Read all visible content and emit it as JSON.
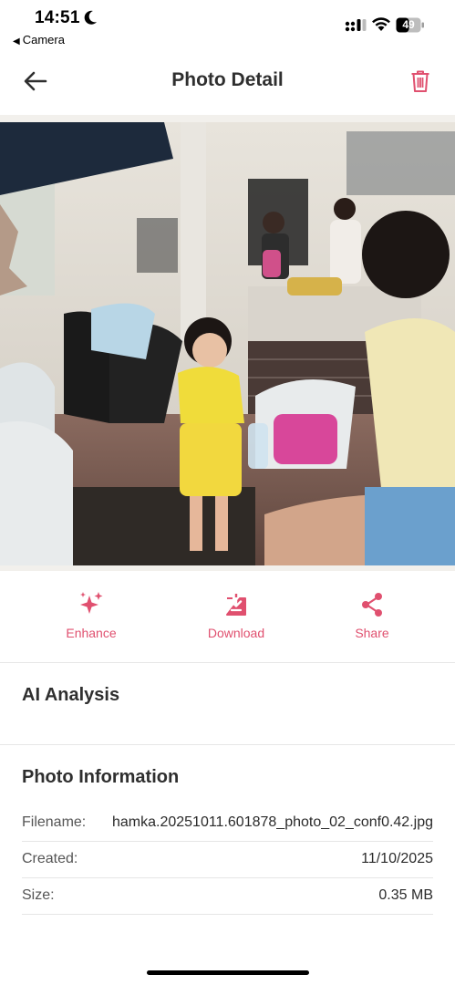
{
  "status_bar": {
    "time": "14:51",
    "back_app": "Camera",
    "battery": "49"
  },
  "header": {
    "title": "Photo Detail"
  },
  "actions": [
    {
      "label": "Enhance",
      "icon": "sparkles-icon"
    },
    {
      "label": "Download",
      "icon": "download-icon"
    },
    {
      "label": "Share",
      "icon": "share-icon"
    }
  ],
  "sections": {
    "ai_analysis": "AI Analysis",
    "photo_information": "Photo Information"
  },
  "info": {
    "filename_label": "Filename:",
    "filename_value": "hamka.20251011.601878_photo_02_conf0.42.jpg",
    "created_label": "Created:",
    "created_value": "11/10/2025",
    "size_label": "Size:",
    "size_value": "0.35 MB"
  },
  "colors": {
    "accent": "#e0506f",
    "text": "#2f2f2f",
    "divider": "#e6e6e6"
  }
}
